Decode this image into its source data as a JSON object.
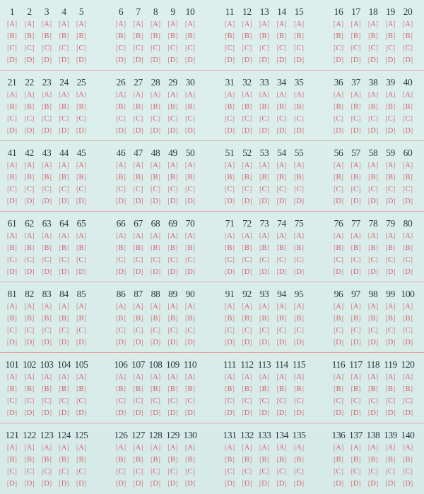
{
  "sheet": {
    "options": [
      "A",
      "B",
      "C",
      "D"
    ],
    "rows": [
      {
        "groups": [
          [
            1,
            2,
            3,
            4,
            5
          ],
          [
            6,
            7,
            8,
            9,
            10
          ],
          [
            11,
            12,
            13,
            14,
            15
          ],
          [
            16,
            17,
            18,
            19,
            20
          ]
        ]
      },
      {
        "groups": [
          [
            21,
            22,
            23,
            24,
            25
          ],
          [
            26,
            27,
            28,
            29,
            30
          ],
          [
            31,
            32,
            33,
            34,
            35
          ],
          [
            36,
            37,
            38,
            39,
            40
          ]
        ]
      },
      {
        "groups": [
          [
            41,
            42,
            43,
            44,
            45
          ],
          [
            46,
            47,
            48,
            49,
            50
          ],
          [
            51,
            52,
            53,
            54,
            55
          ],
          [
            56,
            57,
            58,
            59,
            60
          ]
        ]
      },
      {
        "groups": [
          [
            61,
            62,
            63,
            64,
            65
          ],
          [
            66,
            67,
            68,
            69,
            70
          ],
          [
            71,
            72,
            73,
            74,
            75
          ],
          [
            76,
            77,
            78,
            79,
            80
          ]
        ]
      },
      {
        "groups": [
          [
            81,
            82,
            83,
            84,
            85
          ],
          [
            86,
            87,
            88,
            89,
            90
          ],
          [
            91,
            92,
            93,
            94,
            95
          ],
          [
            96,
            97,
            98,
            99,
            100
          ]
        ]
      },
      {
        "groups": [
          [
            101,
            102,
            103,
            104,
            105
          ],
          [
            106,
            107,
            108,
            109,
            110
          ],
          [
            111,
            112,
            113,
            114,
            115
          ],
          [
            116,
            117,
            118,
            119,
            120
          ]
        ]
      },
      {
        "groups": [
          [
            121,
            122,
            123,
            124,
            125
          ],
          [
            126,
            127,
            128,
            129,
            130
          ],
          [
            131,
            132,
            133,
            134,
            135
          ],
          [
            136,
            137,
            138,
            139,
            140
          ]
        ]
      }
    ]
  },
  "colors": {
    "background": "#d9ece9",
    "number_text": "#2e3a44",
    "option_text": "#d0626e",
    "divider": "#e5a5ac"
  }
}
